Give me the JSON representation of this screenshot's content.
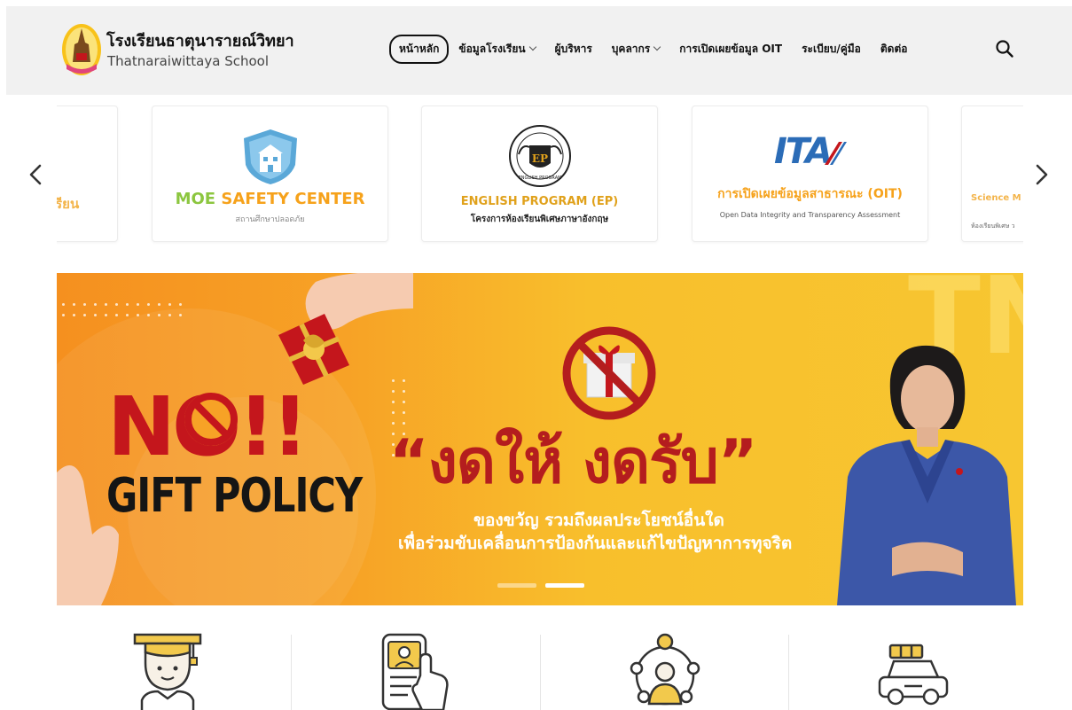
{
  "header": {
    "school_name_th": "โรงเรียนธาตุนารายณ์วิทยา",
    "school_name_en": "Thatnaraiwittaya School",
    "nav": [
      {
        "label": "หน้าหลัก",
        "has_dropdown": false,
        "active": true
      },
      {
        "label": "ข้อมูลโรงเรียน",
        "has_dropdown": true
      },
      {
        "label": "ผู้บริหาร",
        "has_dropdown": false
      },
      {
        "label": "บุคลากร",
        "has_dropdown": true
      },
      {
        "label": "การเปิดเผยข้อมูล OIT",
        "has_dropdown": false
      },
      {
        "label": "ระเบียบ/คู่มือ",
        "has_dropdown": false
      },
      {
        "label": "ติดต่อ",
        "has_dropdown": false
      }
    ]
  },
  "cards": [
    {
      "title": "เรียน"
    },
    {
      "title_a": "MOE",
      "title_b": "SAFETY CENTER",
      "subtitle": "สถานศึกษาปลอดภัย"
    },
    {
      "title": "ENGLISH PROGRAM (EP)",
      "subtitle": "โครงการห้องเรียนพิเศษภาษาอังกฤษ",
      "seal_text": "ENGLISH PROGRAM",
      "seal_letters": "EP"
    },
    {
      "logo_text": "ITA",
      "title": "การเปิดเผยข้อมูลสาธารณะ (OIT)",
      "subtitle": "Open Data Integrity and Transparency Assessment"
    },
    {
      "title": "Science M",
      "subtitle": "ห้องเรียนพิเศษ ว"
    }
  ],
  "banner": {
    "no_text": "NO!!",
    "policy": "GIFT POLICY",
    "slogan": "“งดให้ งดรับ”",
    "line1": "ของขวัญ รวมถึงผลประโยชน์อื่นใด",
    "line2": "เพื่อร่วมขับเคลื่อนการป้องกันและแก้ไขปัญหาการทุจริต",
    "bg_letters": "TN",
    "slides": 2,
    "active_slide": 2
  },
  "quick_links": [
    {
      "icon": "graduate-student-icon"
    },
    {
      "icon": "phone-profile-icon"
    },
    {
      "icon": "network-person-icon"
    },
    {
      "icon": "car-icon"
    }
  ],
  "colors": {
    "accent_red": "#c4161c",
    "header_bg": "#f1f1f1",
    "banner_orange": "#f5901f",
    "banner_yellow": "#f7c631",
    "moe_green": "#8cc63f",
    "moe_orange": "#f6a21b",
    "ep_gold": "#e0a11b",
    "ita_blue": "#2b6cb7",
    "oit_orange": "#f6a21b"
  }
}
